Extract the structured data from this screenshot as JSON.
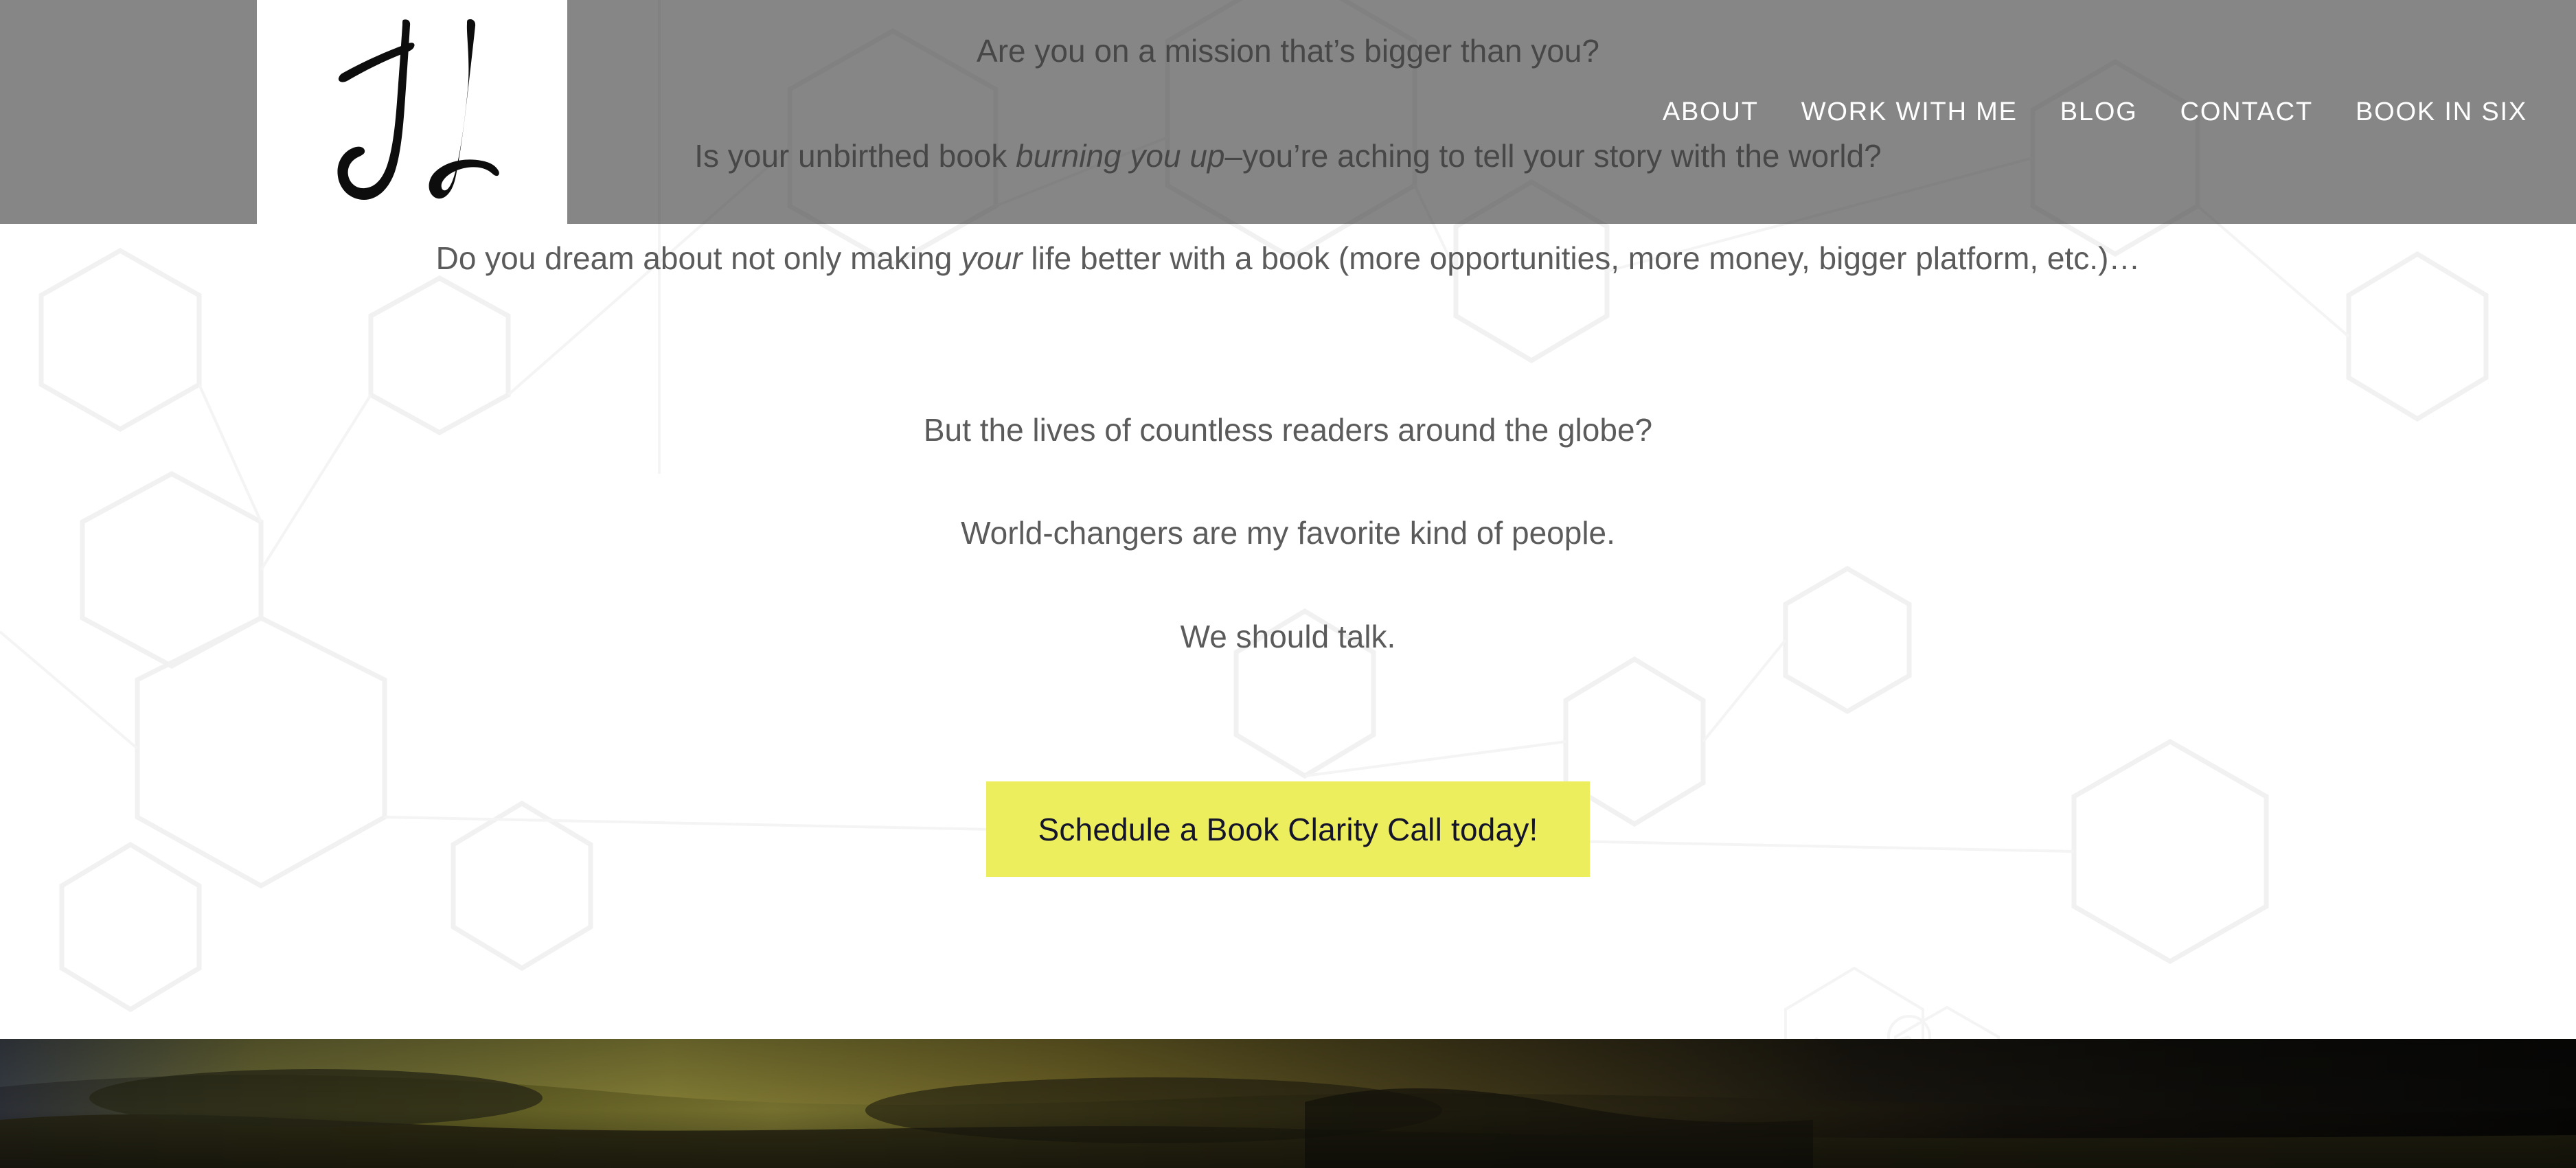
{
  "site": {
    "logo_alt": "JL script monogram",
    "header_overlay_color": "#6e6e6e",
    "accent_color": "#edee5d",
    "body_text_color": "#5b5b5b",
    "cta_text_color": "#14142b"
  },
  "nav": {
    "items": [
      {
        "label": "ABOUT"
      },
      {
        "label": "WORK WITH ME"
      },
      {
        "label": "BLOG"
      },
      {
        "label": "CONTACT"
      },
      {
        "label": "BOOK IN SIX"
      }
    ]
  },
  "hero": {
    "line1": "Are you on a mission that’s bigger than you?",
    "line2_a": "Is your unbirthed book ",
    "line2_em": "burning you up",
    "line2_b": "–you’re aching to tell your story with the world?",
    "line3_a": "Do you dream about not only making ",
    "line3_em": "your",
    "line3_b": " life better with a book (more opportunities, more money, bigger platform, etc.)…",
    "line4": "But the lives of countless readers around the globe?",
    "line5": "World-changers are my favorite kind of people.",
    "line6": "We should talk."
  },
  "cta": {
    "label": "Schedule a Book Clarity Call today!"
  },
  "footer_image": {
    "alt": "dark olive landscape photograph strip"
  }
}
